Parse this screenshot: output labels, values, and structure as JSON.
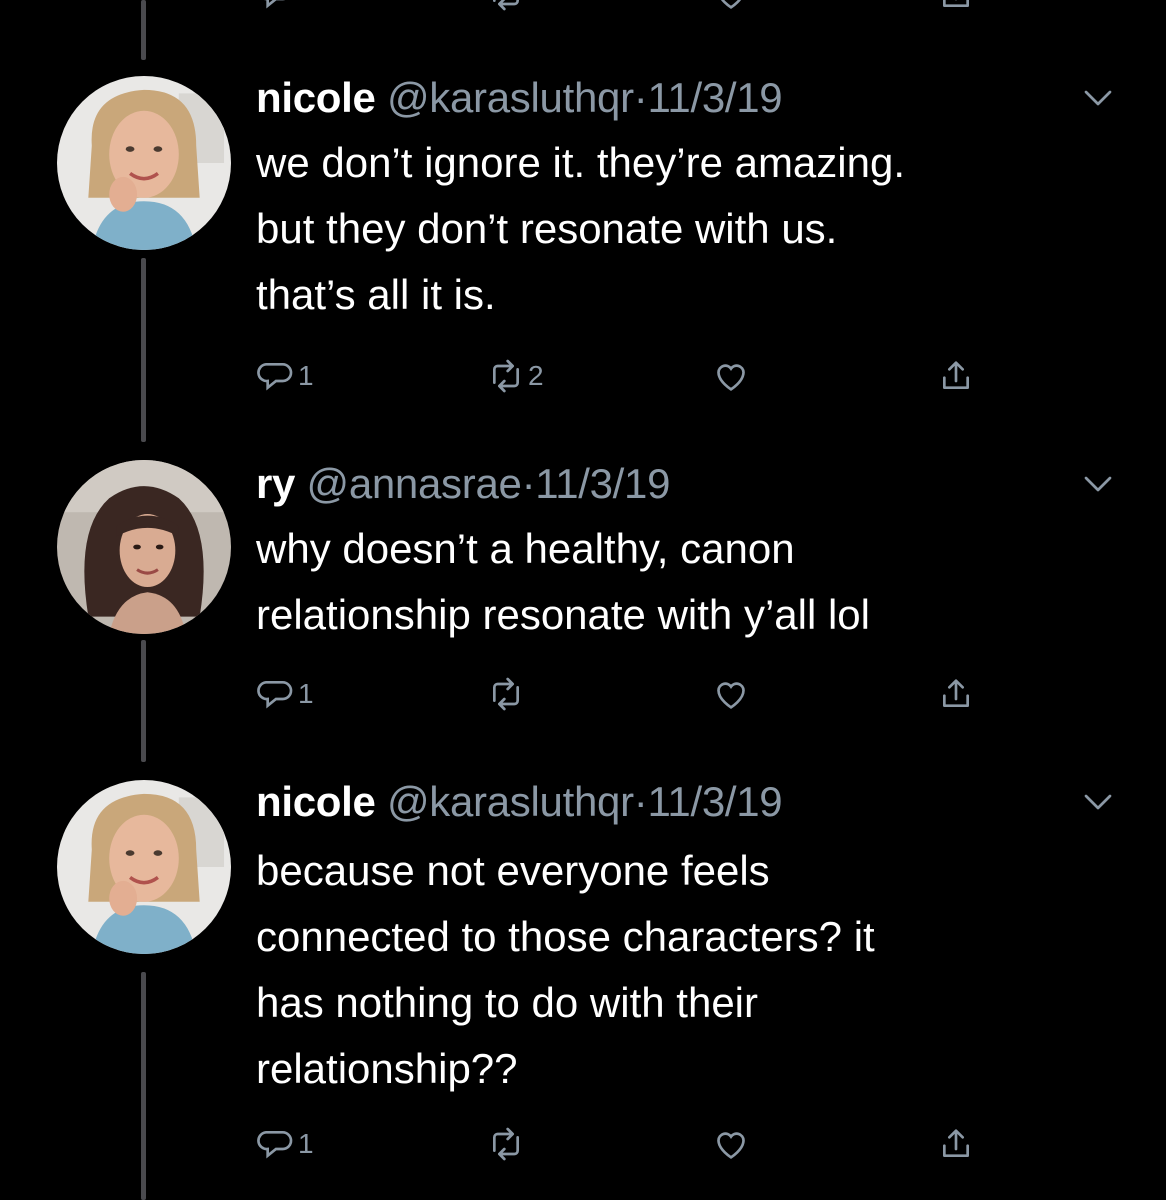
{
  "colors": {
    "background": "#000000",
    "text_primary": "#ffffff",
    "text_secondary": "#8b98a5",
    "thread_line": "#4a4a4e"
  },
  "tweets": [
    {
      "name": "nicole",
      "handle": "@karasluthqr",
      "separator": "·",
      "date": "11/3/19",
      "lines": [
        "we don’t ignore it. they’re amazing.",
        "but they don’t resonate with us.",
        "that’s all it is."
      ],
      "reply_count": "1",
      "retweet_count": "2",
      "icons": [
        "reply-icon",
        "retweet-icon",
        "like-icon",
        "share-icon",
        "chevron-down-icon"
      ]
    },
    {
      "name": "ry",
      "handle": "@annasrae",
      "separator": "·",
      "date": "11/3/19",
      "lines": [
        "why doesn’t a healthy, canon",
        "relationship resonate with y’all lol"
      ],
      "reply_count": "1",
      "retweet_count": "",
      "icons": [
        "reply-icon",
        "retweet-icon",
        "like-icon",
        "share-icon",
        "chevron-down-icon"
      ]
    },
    {
      "name": "nicole",
      "handle": "@karasluthqr",
      "separator": "·",
      "date": "11/3/19",
      "lines": [
        "because not everyone feels",
        "connected to those characters? it",
        "has nothing to do with their",
        "relationship??"
      ],
      "reply_count": "1",
      "retweet_count": "",
      "icons": [
        "reply-icon",
        "retweet-icon",
        "like-icon",
        "share-icon",
        "chevron-down-icon"
      ]
    }
  ]
}
